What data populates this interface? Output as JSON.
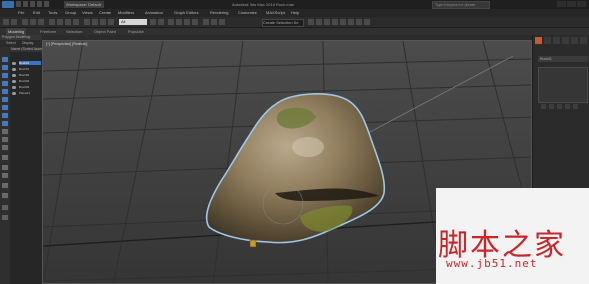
{
  "titlebar": {
    "workspace": "Workspace: Default",
    "app_title": "Autodesk 3ds Max 2016    Rock.max",
    "search_placeholder": "Type a keyword or phrase"
  },
  "menu": [
    "File",
    "Edit",
    "Tools",
    "Group",
    "Views",
    "Create",
    "Modifiers",
    "Animation",
    "Graph Editors",
    "Rendering",
    "Customize",
    "MAXScript",
    "Help"
  ],
  "toolbar": {
    "selection_set": "All",
    "named_selection": "Create Selection Se"
  },
  "ribbon": {
    "tabs": [
      "Modeling",
      "Freeform",
      "Selection",
      "Object Paint",
      "Populate"
    ],
    "active_tab": "Modeling",
    "sub_label": "Polygon Modeling"
  },
  "scene_explorer": {
    "tabs": [
      "Select",
      "Display"
    ],
    "header": "Name (Sorted Ascending)",
    "items": [
      "Rock01",
      "Box001",
      "Box002",
      "Box003",
      "Box004",
      "Plane01"
    ]
  },
  "viewport": {
    "label": "[+] [Perspective] [Realistic]"
  },
  "command_panel": {
    "object_name": "Rock01"
  },
  "watermark": {
    "logo_text": "脚本之家",
    "url": "www.jb51.net"
  }
}
